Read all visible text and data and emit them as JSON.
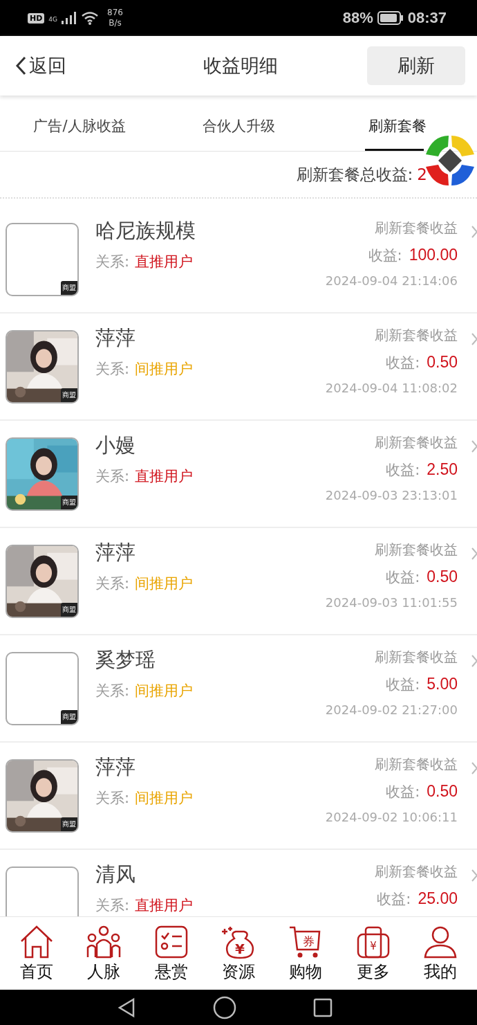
{
  "status_bar": {
    "hd": "HD",
    "network": "4G",
    "speed_value": "876",
    "speed_unit": "B/s",
    "battery": "88%",
    "time": "08:37"
  },
  "header": {
    "back": "返回",
    "title": "收益明细",
    "action": "刷新"
  },
  "tabs": [
    {
      "label": "广告/人脉收益",
      "selected": false
    },
    {
      "label": "合伙人升级",
      "selected": false
    },
    {
      "label": "刷新套餐",
      "selected": true
    }
  ],
  "total": {
    "label": "刷新套餐总收益:",
    "value": "2"
  },
  "records": [
    {
      "name": "哈尼族规模",
      "kind": "blank",
      "badge": "商盟",
      "relation_label": "关系:",
      "relation": {
        "text": "直推用户",
        "color": "#d0121b"
      },
      "type": "刷新套餐收益",
      "amount_label": "收益:",
      "amount": "100.00",
      "time": "2024-09-04 21:14:06"
    },
    {
      "name": "萍萍",
      "kind": "picture",
      "badge": "商盟",
      "relation_label": "关系:",
      "relation": {
        "text": "间推用户",
        "color": "#e9a400"
      },
      "type": "刷新套餐收益",
      "amount_label": "收益:",
      "amount": "0.50",
      "time": "2024-09-04 11:08:02"
    },
    {
      "name": "小嫚",
      "kind": "picture",
      "badge": "商盟",
      "relation_label": "关系:",
      "relation": {
        "text": "直推用户",
        "color": "#d0121b"
      },
      "type": "刷新套餐收益",
      "amount_label": "收益:",
      "amount": "2.50",
      "time": "2024-09-03 23:13:01"
    },
    {
      "name": "萍萍",
      "kind": "picture",
      "badge": "商盟",
      "relation_label": "关系:",
      "relation": {
        "text": "间推用户",
        "color": "#e9a400"
      },
      "type": "刷新套餐收益",
      "amount_label": "收益:",
      "amount": "0.50",
      "time": "2024-09-03 11:01:55"
    },
    {
      "name": "奚梦瑶",
      "kind": "blank",
      "badge": "商盟",
      "relation_label": "关系:",
      "relation": {
        "text": "间推用户",
        "color": "#e9a400"
      },
      "type": "刷新套餐收益",
      "amount_label": "收益:",
      "amount": "5.00",
      "time": "2024-09-02 21:27:00"
    },
    {
      "name": "萍萍",
      "kind": "picture",
      "badge": "商盟",
      "relation_label": "关系:",
      "relation": {
        "text": "间推用户",
        "color": "#e9a400"
      },
      "type": "刷新套餐收益",
      "amount_label": "收益:",
      "amount": "0.50",
      "time": "2024-09-02 10:06:11"
    },
    {
      "name": "清风",
      "kind": "blank",
      "relation_label": "关系:",
      "relation": {
        "text": "直推用户",
        "color": "#d0121b"
      },
      "type": "刷新套餐收益",
      "amount_label": "收益:",
      "amount": "25.00"
    }
  ],
  "bottom_nav": [
    {
      "label": "首页",
      "kind": "home"
    },
    {
      "label": "人脉",
      "kind": "people"
    },
    {
      "label": "悬赏",
      "kind": "tasks"
    },
    {
      "label": "资源",
      "kind": "moneybag",
      "glyph": "¥"
    },
    {
      "label": "购物",
      "kind": "cart",
      "glyph": "券"
    },
    {
      "label": "更多",
      "kind": "luggage",
      "glyph": "¥"
    },
    {
      "label": "我的",
      "kind": "user"
    }
  ]
}
